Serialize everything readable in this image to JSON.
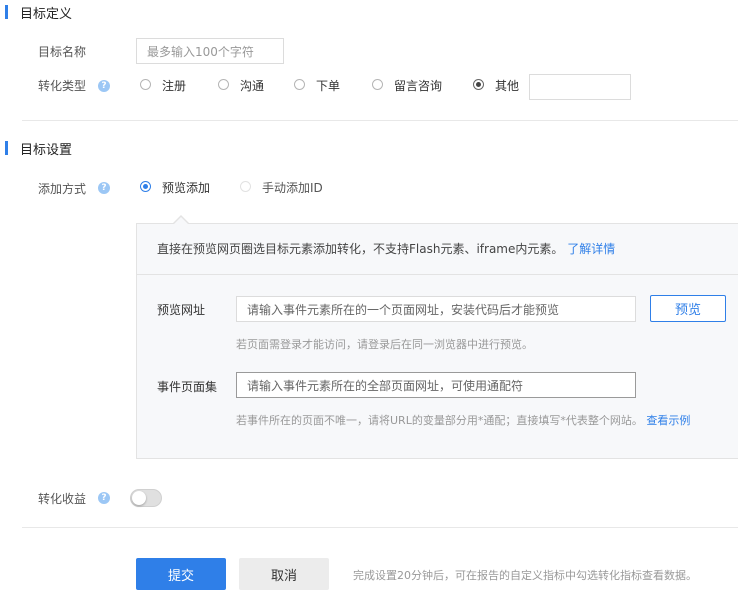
{
  "section1": {
    "title": "目标定义",
    "name_label": "目标名称",
    "name_placeholder": "最多输入100个字符",
    "type_label": "转化类型",
    "type_options": [
      "注册",
      "沟通",
      "下单",
      "留言咨询",
      "其他"
    ],
    "type_selected": "其他"
  },
  "section2": {
    "title": "目标设置",
    "method_label": "添加方式",
    "method_options": [
      "预览添加",
      "手动添加ID"
    ],
    "method_selected": "预览添加",
    "panel": {
      "intro": "直接在预览网页圈选目标元素添加转化，不支持Flash元素、iframe内元素。",
      "intro_link": "了解详情",
      "preview_url_label": "预览网址",
      "preview_url_placeholder": "请输入事件元素所在的一个页面网址，安装代码后才能预览",
      "preview_button": "预览",
      "preview_hint": "若页面需登录才能访问，请登录后在同一浏览器中进行预览。",
      "page_set_label": "事件页面集",
      "page_set_placeholder": "请输入事件元素所在的全部页面网址，可使用通配符",
      "page_set_hint": "若事件所在的页面不唯一，请将URL的变量部分用*通配；直接填写*代表整个网站。",
      "page_set_link": "查看示例"
    },
    "revenue_label": "转化收益",
    "revenue_enabled": false
  },
  "footer": {
    "submit": "提交",
    "cancel": "取消",
    "note": "完成设置20分钟后，可在报告的自定义指标中勾选转化指标查看数据。"
  },
  "help_icon_glyph": "?",
  "colors": {
    "accent": "#2f7fe8",
    "muted": "#999999",
    "border": "#dcdcdc"
  }
}
